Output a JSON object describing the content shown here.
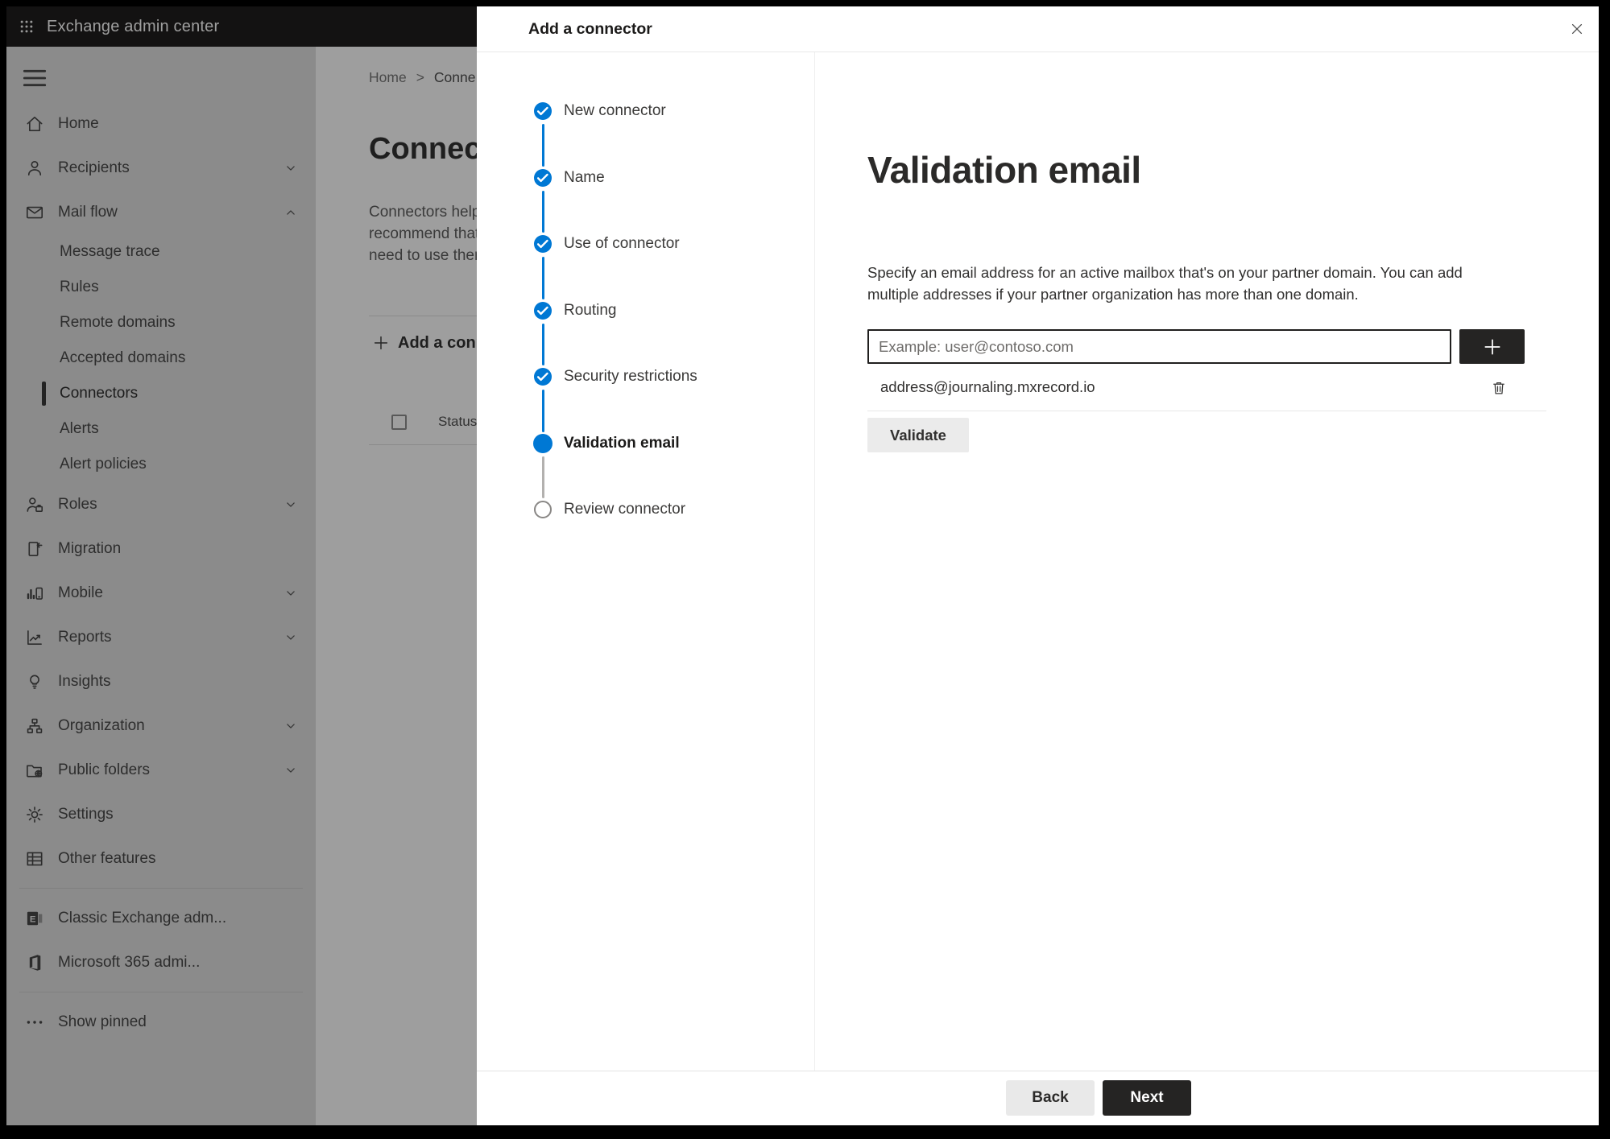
{
  "topbar": {
    "title": "Exchange admin center"
  },
  "sidebar": {
    "items": [
      {
        "id": "home",
        "label": "Home",
        "icon": "home"
      },
      {
        "id": "recipients",
        "label": "Recipients",
        "icon": "person",
        "chevron": "down"
      },
      {
        "id": "mail-flow",
        "label": "Mail flow",
        "icon": "mail",
        "chevron": "up"
      },
      {
        "id": "message-trace",
        "label": "Message trace",
        "sub": true
      },
      {
        "id": "rules",
        "label": "Rules",
        "sub": true
      },
      {
        "id": "remote-domains",
        "label": "Remote domains",
        "sub": true
      },
      {
        "id": "accepted-domains",
        "label": "Accepted domains",
        "sub": true
      },
      {
        "id": "connectors",
        "label": "Connectors",
        "sub": true,
        "selected": true
      },
      {
        "id": "alerts",
        "label": "Alerts",
        "sub": true
      },
      {
        "id": "alert-policies",
        "label": "Alert policies",
        "sub": true
      },
      {
        "id": "roles",
        "label": "Roles",
        "icon": "roles",
        "chevron": "down"
      },
      {
        "id": "migration",
        "label": "Migration",
        "icon": "migration"
      },
      {
        "id": "mobile",
        "label": "Mobile",
        "icon": "mobile",
        "chevron": "down"
      },
      {
        "id": "reports",
        "label": "Reports",
        "icon": "reports",
        "chevron": "down"
      },
      {
        "id": "insights",
        "label": "Insights",
        "icon": "insights"
      },
      {
        "id": "organization",
        "label": "Organization",
        "icon": "organization",
        "chevron": "down"
      },
      {
        "id": "public-folders",
        "label": "Public folders",
        "icon": "public-folders",
        "chevron": "down"
      },
      {
        "id": "settings",
        "label": "Settings",
        "icon": "settings"
      },
      {
        "id": "other-features",
        "label": "Other features",
        "icon": "grid"
      },
      {
        "id": "classic-exchange-admin",
        "label": "Classic Exchange adm...",
        "icon": "exchange-logo",
        "divider_before": true
      },
      {
        "id": "microsoft-365-admin",
        "label": "Microsoft 365 admi...",
        "icon": "office-logo"
      },
      {
        "id": "show-pinned",
        "label": "Show pinned",
        "icon": "ellipsis",
        "divider_before": true
      }
    ]
  },
  "page": {
    "breadcrumb": {
      "home": "Home",
      "separator": ">",
      "current": "Conne"
    },
    "title": "Connec",
    "description": "Connectors help\nrecommend that\nneed to use ther",
    "add_button": "Add a conn",
    "status_column": "Status"
  },
  "panel": {
    "title": "Add a connector",
    "steps": [
      {
        "id": "new-connector",
        "label": "New connector",
        "state": "completed"
      },
      {
        "id": "name",
        "label": "Name",
        "state": "completed"
      },
      {
        "id": "use-of-connector",
        "label": "Use of connector",
        "state": "completed"
      },
      {
        "id": "routing",
        "label": "Routing",
        "state": "completed"
      },
      {
        "id": "security-restrictions",
        "label": "Security restrictions",
        "state": "completed"
      },
      {
        "id": "validation-email",
        "label": "Validation email",
        "state": "current"
      },
      {
        "id": "review-connector",
        "label": "Review connector",
        "state": "upcoming"
      }
    ],
    "heading": "Validation email",
    "description": "Specify an email address for an active mailbox that's on your partner domain. You can add\nmultiple addresses if your partner organization has more than one domain.",
    "email_input": {
      "value": "",
      "placeholder": "Example: user@contoso.com"
    },
    "addresses": [
      "address@journaling.mxrecord.io"
    ],
    "validate_button": "Validate",
    "back_button": "Back",
    "next_button": "Next"
  },
  "colors": {
    "accent": "#0078d4",
    "primary_button": "#252423",
    "topbar_bg": "#1f1e1d",
    "step_pending_line": "#b3b1af"
  }
}
